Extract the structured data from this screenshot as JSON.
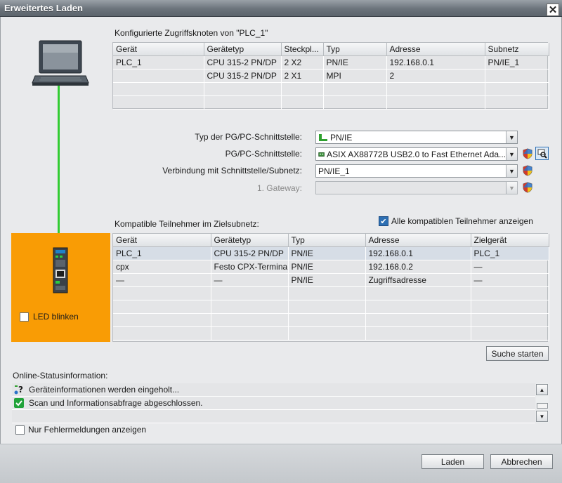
{
  "window": {
    "title": "Erweitertes Laden",
    "close_glyph": "✕"
  },
  "configured": {
    "heading": "Konfigurierte Zugriffsknoten von \"PLC_1\"",
    "columns": [
      "Gerät",
      "Gerätetyp",
      "Steckpl...",
      "Typ",
      "Adresse",
      "Subnetz"
    ],
    "rows": [
      [
        "PLC_1",
        "CPU 315-2 PN/DP",
        "2 X2",
        "PN/IE",
        "192.168.0.1",
        "PN/IE_1"
      ],
      [
        "",
        "CPU 315-2 PN/DP",
        "2 X1",
        "MPI",
        "2",
        ""
      ],
      [
        "",
        "",
        "",
        "",
        "",
        ""
      ],
      [
        "",
        "",
        "",
        "",
        "",
        ""
      ]
    ]
  },
  "interface": {
    "type_label": "Typ der PG/PC-Schnittstelle:",
    "type_value": "PN/IE",
    "pgpc_label": "PG/PC-Schnittstelle:",
    "pgpc_value": "ASIX AX88772B USB2.0 to Fast Ethernet Ada...",
    "connection_label": "Verbindung mit Schnittstelle/Subnetz:",
    "connection_value": "PN/IE_1",
    "gateway_label": "1. Gateway:",
    "gateway_value": ""
  },
  "compatible": {
    "heading": "Kompatible Teilnehmer im Zielsubnetz:",
    "show_all_label": "Alle kompatiblen Teilnehmer anzeigen",
    "show_all_checked": true,
    "columns": [
      "Gerät",
      "Gerätetyp",
      "Typ",
      "Adresse",
      "Zielgerät"
    ],
    "rows": [
      [
        "PLC_1",
        "CPU 315-2 PN/DP",
        "PN/IE",
        "192.168.0.1",
        "PLC_1"
      ],
      [
        "cpx",
        "Festo CPX-Terminal",
        "PN/IE",
        "192.168.0.2",
        "—"
      ],
      [
        "—",
        "—",
        "PN/IE",
        "Zugriffsadresse",
        "—"
      ],
      [
        "",
        "",
        "",
        "",
        ""
      ],
      [
        "",
        "",
        "",
        "",
        ""
      ],
      [
        "",
        "",
        "",
        "",
        ""
      ],
      [
        "",
        "",
        "",
        "",
        ""
      ]
    ],
    "selected_row": 0
  },
  "led_blink_label": "LED blinken",
  "search_button": "Suche starten",
  "status": {
    "heading": "Online-Statusinformation:",
    "items": [
      {
        "icon": "info-question-icon",
        "text": "Geräteinformationen werden eingeholt..."
      },
      {
        "icon": "success-check-icon",
        "text": "Scan und Informationsabfrage abgeschlossen."
      }
    ]
  },
  "errors_only_label": "Nur Fehlermeldungen anzeigen",
  "buttons": {
    "load": "Laden",
    "cancel": "Abbrechen"
  },
  "colors": {
    "target_panel": "#f99c05",
    "link_line": "#33cc33",
    "title_bar": "#6b737b"
  }
}
